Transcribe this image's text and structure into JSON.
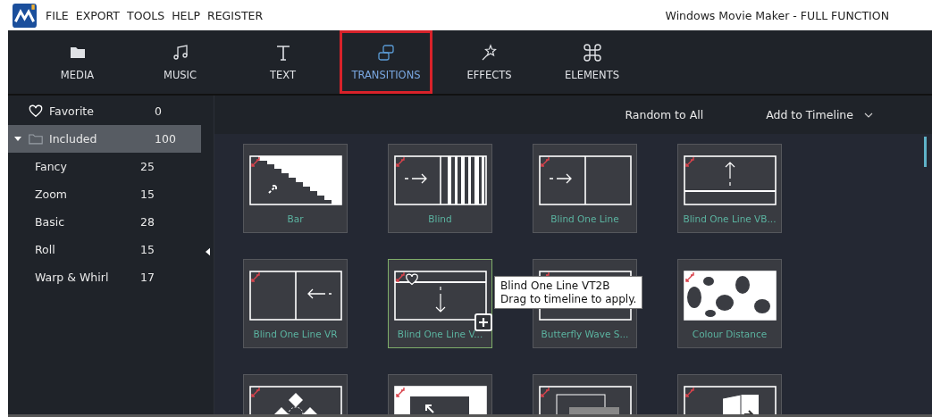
{
  "menu": [
    "FILE",
    "EXPORT",
    "TOOLS",
    "HELP",
    "REGISTER"
  ],
  "window": {
    "title": "Windows Movie Maker - FULL FUNCTION"
  },
  "tabs": [
    {
      "label": "MEDIA",
      "kind": "folder",
      "selected": false
    },
    {
      "label": "MUSIC",
      "kind": "music",
      "selected": false
    },
    {
      "label": "TEXT",
      "kind": "text",
      "selected": false
    },
    {
      "label": "TRANSITIONS",
      "kind": "transitions",
      "selected": true
    },
    {
      "label": "EFFECTS",
      "kind": "effects",
      "selected": false
    },
    {
      "label": "ELEMENTS",
      "kind": "elements",
      "selected": false
    }
  ],
  "sidebar": {
    "items": [
      {
        "label": "Favorite",
        "count": "0",
        "kind": "heart",
        "selected": false
      },
      {
        "label": "Included",
        "count": "100",
        "kind": "folder",
        "selected": true,
        "expanded": true,
        "children": [
          {
            "label": "Fancy",
            "count": "25",
            "selected": false
          },
          {
            "label": "Zoom",
            "count": "15",
            "selected": false
          },
          {
            "label": "Basic",
            "count": "28",
            "selected": false
          },
          {
            "label": "Roll",
            "count": "15",
            "selected": false
          },
          {
            "label": "Warp & Whirl",
            "count": "17",
            "selected": false
          }
        ]
      }
    ]
  },
  "toolbar": {
    "random": "Random to All",
    "add": "Add to Timeline"
  },
  "tiles": [
    {
      "label": "Bar",
      "kind": "bar",
      "hovered": false
    },
    {
      "label": "Blind",
      "kind": "blind",
      "hovered": false
    },
    {
      "label": "Blind One Line",
      "kind": "line",
      "hovered": false
    },
    {
      "label": "Blind One Line VB...",
      "kind": "vb",
      "hovered": false
    },
    {
      "label": "Blind One Line VR",
      "kind": "vr",
      "hovered": false
    },
    {
      "label": "Blind One Line V...",
      "kind": "vt2b",
      "hovered": true
    },
    {
      "label": "Butterfly Wave S...",
      "kind": "butterfly",
      "hovered": false
    },
    {
      "label": "Colour Distance",
      "kind": "blobs",
      "hovered": false
    },
    {
      "kind": "diamond",
      "hovered": false
    },
    {
      "kind": "zoom",
      "hovered": false
    },
    {
      "kind": "overlap",
      "hovered": false
    },
    {
      "kind": "cube",
      "hovered": false
    }
  ],
  "tooltip": {
    "title": "Blind One Line VT2B",
    "hint": "Drag to timeline to apply."
  }
}
